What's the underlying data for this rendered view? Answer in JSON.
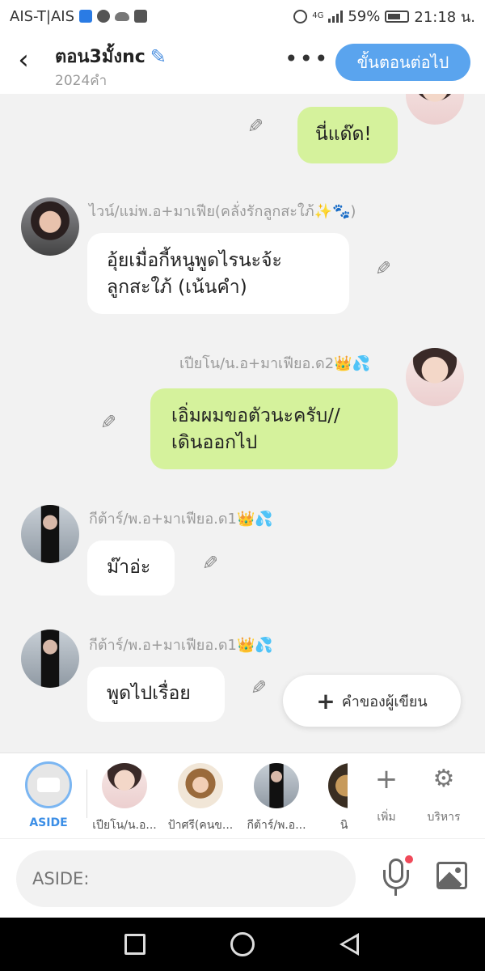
{
  "status_bar": {
    "carrier": "AIS-T|AIS",
    "network": "4G",
    "battery": "59%",
    "time": "21:18 น."
  },
  "header": {
    "title": "ตอน3มั้งnc",
    "subtitle": "2024คำ",
    "more_label": "•••",
    "next_button": "ขั้นตอนต่อไป"
  },
  "messages": [
    {
      "side": "right",
      "name": "",
      "text": "นี่แด๊ด!",
      "color": "#d5f29c"
    },
    {
      "side": "left",
      "name": "ไวน์/แม่พ.อ+มาเฟีย(คลั่งรักลูกสะใภ้✨🐾)",
      "text": "อุ้ยเมื่อกี้หนูพูดไรนะจ้ะ\nลูกสะใภ้  (เน้นคำ)",
      "color": "#ffffff"
    },
    {
      "side": "right",
      "name": "เปียโน/น.อ+มาเฟียอ.ด2👑💦",
      "text": "เอิ่มผมขอตัวนะครับ//\nเดินออกไป",
      "color": "#d5f29c"
    },
    {
      "side": "left",
      "name": "กีต้าร์/พ.อ+มาเฟียอ.ด1👑💦",
      "text": "ม๊าอ่ะ",
      "color": "#ffffff"
    },
    {
      "side": "left",
      "name": "กีต้าร์/พ.อ+มาเฟียอ.ด1👑💦",
      "text": "พูดไปเรื่อย",
      "color": "#ffffff"
    }
  ],
  "author_button": "คำของผู้เขียน",
  "characters": {
    "aside_label": "ASIDE",
    "items": [
      {
        "label": "เปียโน/น.อ..."
      },
      {
        "label": "ป้าศรี(คนข..."
      },
      {
        "label": "กีต้าร์/พ.อ..."
      },
      {
        "label": "นิร"
      }
    ],
    "add_label": "เพิ่ม",
    "manage_label": "บริหาร"
  },
  "input": {
    "placeholder": "ASIDE:"
  },
  "colors": {
    "accent": "#5aa4ee",
    "green_bubble": "#d5f29c"
  }
}
